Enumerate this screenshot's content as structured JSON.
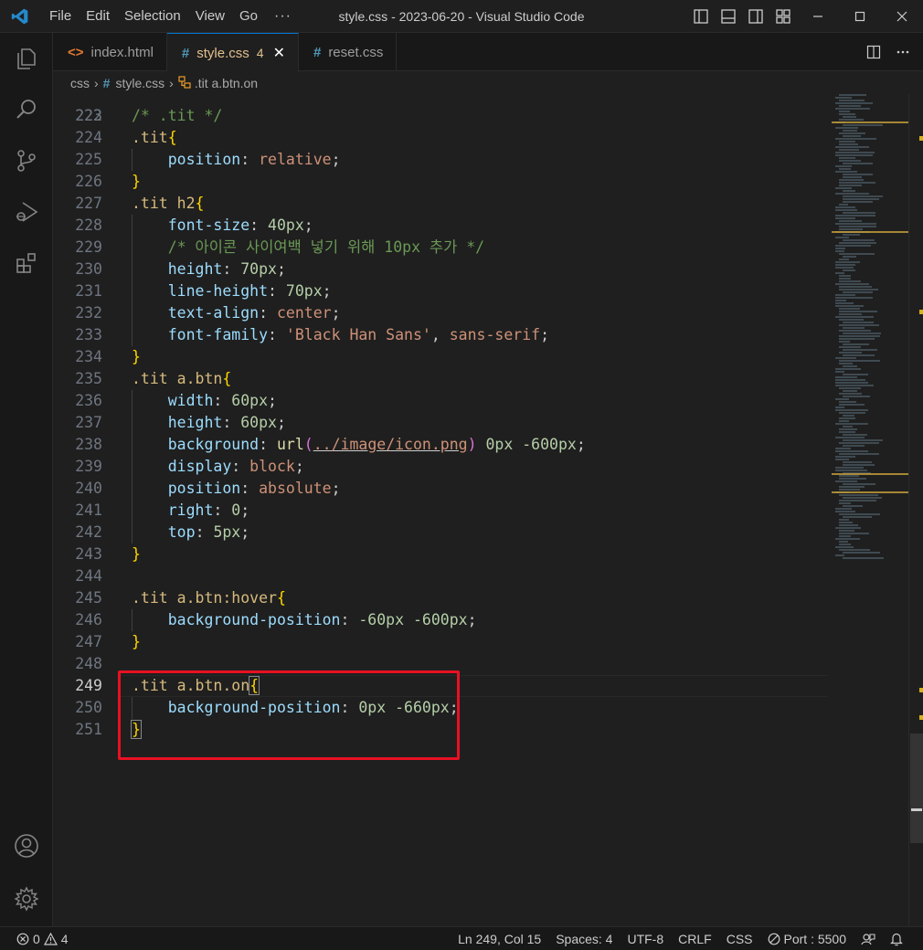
{
  "window": {
    "title": "style.css - 2023-06-20 - Visual Studio Code",
    "menu": [
      "File",
      "Edit",
      "Selection",
      "View",
      "Go"
    ],
    "menu_more": "···"
  },
  "tabs": [
    {
      "label": "index.html",
      "icon": "html-file-icon",
      "active": false
    },
    {
      "label": "style.css",
      "icon": "css-file-icon",
      "active": true,
      "problems": "4"
    },
    {
      "label": "reset.css",
      "icon": "css-file-icon",
      "active": false
    }
  ],
  "breadcrumb": {
    "folder": "css",
    "file": "style.css",
    "symbol": ".tit a.btn.on"
  },
  "editor": {
    "current_line": 249,
    "partial_top_line": "222",
    "lines": [
      {
        "n": "223",
        "tokens": [
          {
            "t": "/* .tit */",
            "c": "com"
          }
        ]
      },
      {
        "n": "224",
        "tokens": [
          {
            "t": ".tit",
            "c": "sel"
          },
          {
            "t": "{",
            "c": "br"
          }
        ]
      },
      {
        "n": "225",
        "tokens": [
          {
            "t": "    ",
            "c": "pun"
          },
          {
            "t": "position",
            "c": "prop"
          },
          {
            "t": ": ",
            "c": "pun"
          },
          {
            "t": "relative",
            "c": "val"
          },
          {
            "t": ";",
            "c": "pun"
          }
        ]
      },
      {
        "n": "226",
        "tokens": [
          {
            "t": "}",
            "c": "br"
          }
        ]
      },
      {
        "n": "227",
        "tokens": [
          {
            "t": ".tit h2",
            "c": "sel"
          },
          {
            "t": "{",
            "c": "br"
          }
        ]
      },
      {
        "n": "228",
        "tokens": [
          {
            "t": "    ",
            "c": "pun"
          },
          {
            "t": "font-size",
            "c": "prop"
          },
          {
            "t": ": ",
            "c": "pun"
          },
          {
            "t": "40px",
            "c": "num"
          },
          {
            "t": ";",
            "c": "pun"
          }
        ]
      },
      {
        "n": "229",
        "tokens": [
          {
            "t": "    ",
            "c": "pun"
          },
          {
            "t": "/* 아이콘 사이여백 넣기 위해 10px 추가 */",
            "c": "com"
          }
        ]
      },
      {
        "n": "230",
        "tokens": [
          {
            "t": "    ",
            "c": "pun"
          },
          {
            "t": "height",
            "c": "prop"
          },
          {
            "t": ": ",
            "c": "pun"
          },
          {
            "t": "70px",
            "c": "num"
          },
          {
            "t": ";",
            "c": "pun"
          }
        ]
      },
      {
        "n": "231",
        "tokens": [
          {
            "t": "    ",
            "c": "pun"
          },
          {
            "t": "line-height",
            "c": "prop"
          },
          {
            "t": ": ",
            "c": "pun"
          },
          {
            "t": "70px",
            "c": "num"
          },
          {
            "t": ";",
            "c": "pun"
          }
        ]
      },
      {
        "n": "232",
        "tokens": [
          {
            "t": "    ",
            "c": "pun"
          },
          {
            "t": "text-align",
            "c": "prop"
          },
          {
            "t": ": ",
            "c": "pun"
          },
          {
            "t": "center",
            "c": "val"
          },
          {
            "t": ";",
            "c": "pun"
          }
        ]
      },
      {
        "n": "233",
        "tokens": [
          {
            "t": "    ",
            "c": "pun"
          },
          {
            "t": "font-family",
            "c": "prop"
          },
          {
            "t": ": ",
            "c": "pun"
          },
          {
            "t": "'Black Han Sans'",
            "c": "str"
          },
          {
            "t": ", ",
            "c": "pun"
          },
          {
            "t": "sans-serif",
            "c": "val"
          },
          {
            "t": ";",
            "c": "pun"
          }
        ]
      },
      {
        "n": "234",
        "tokens": [
          {
            "t": "}",
            "c": "br"
          }
        ]
      },
      {
        "n": "235",
        "tokens": [
          {
            "t": ".tit a.btn",
            "c": "sel"
          },
          {
            "t": "{",
            "c": "br"
          }
        ]
      },
      {
        "n": "236",
        "tokens": [
          {
            "t": "    ",
            "c": "pun"
          },
          {
            "t": "width",
            "c": "prop"
          },
          {
            "t": ": ",
            "c": "pun"
          },
          {
            "t": "60px",
            "c": "num"
          },
          {
            "t": ";",
            "c": "pun"
          }
        ]
      },
      {
        "n": "237",
        "tokens": [
          {
            "t": "    ",
            "c": "pun"
          },
          {
            "t": "height",
            "c": "prop"
          },
          {
            "t": ": ",
            "c": "pun"
          },
          {
            "t": "60px",
            "c": "num"
          },
          {
            "t": ";",
            "c": "pun"
          }
        ]
      },
      {
        "n": "238",
        "tokens": [
          {
            "t": "    ",
            "c": "pun"
          },
          {
            "t": "background",
            "c": "prop"
          },
          {
            "t": ": ",
            "c": "pun"
          },
          {
            "t": "url",
            "c": "fn"
          },
          {
            "t": "(",
            "c": "par"
          },
          {
            "t": "../image/icon.png",
            "c": "url"
          },
          {
            "t": ")",
            "c": "par"
          },
          {
            "t": " ",
            "c": "pun"
          },
          {
            "t": "0px",
            "c": "num"
          },
          {
            "t": " ",
            "c": "pun"
          },
          {
            "t": "-600px",
            "c": "num"
          },
          {
            "t": ";",
            "c": "pun"
          }
        ]
      },
      {
        "n": "239",
        "tokens": [
          {
            "t": "    ",
            "c": "pun"
          },
          {
            "t": "display",
            "c": "prop"
          },
          {
            "t": ": ",
            "c": "pun"
          },
          {
            "t": "block",
            "c": "val"
          },
          {
            "t": ";",
            "c": "pun"
          }
        ]
      },
      {
        "n": "240",
        "tokens": [
          {
            "t": "    ",
            "c": "pun"
          },
          {
            "t": "position",
            "c": "prop"
          },
          {
            "t": ": ",
            "c": "pun"
          },
          {
            "t": "absolute",
            "c": "val"
          },
          {
            "t": ";",
            "c": "pun"
          }
        ]
      },
      {
        "n": "241",
        "tokens": [
          {
            "t": "    ",
            "c": "pun"
          },
          {
            "t": "right",
            "c": "prop"
          },
          {
            "t": ": ",
            "c": "pun"
          },
          {
            "t": "0",
            "c": "num"
          },
          {
            "t": ";",
            "c": "pun"
          }
        ]
      },
      {
        "n": "242",
        "tokens": [
          {
            "t": "    ",
            "c": "pun"
          },
          {
            "t": "top",
            "c": "prop"
          },
          {
            "t": ": ",
            "c": "pun"
          },
          {
            "t": "5px",
            "c": "num"
          },
          {
            "t": ";",
            "c": "pun"
          }
        ]
      },
      {
        "n": "243",
        "tokens": [
          {
            "t": "}",
            "c": "br"
          }
        ]
      },
      {
        "n": "244",
        "tokens": []
      },
      {
        "n": "245",
        "tokens": [
          {
            "t": ".tit a.btn:hover",
            "c": "sel"
          },
          {
            "t": "{",
            "c": "br"
          }
        ]
      },
      {
        "n": "246",
        "tokens": [
          {
            "t": "    ",
            "c": "pun"
          },
          {
            "t": "background-position",
            "c": "prop"
          },
          {
            "t": ": ",
            "c": "pun"
          },
          {
            "t": "-60px",
            "c": "num"
          },
          {
            "t": " ",
            "c": "pun"
          },
          {
            "t": "-600px",
            "c": "num"
          },
          {
            "t": ";",
            "c": "pun"
          }
        ]
      },
      {
        "n": "247",
        "tokens": [
          {
            "t": "}",
            "c": "br"
          }
        ]
      },
      {
        "n": "248",
        "tokens": []
      },
      {
        "n": "249",
        "tokens": [
          {
            "t": ".tit a.btn.on",
            "c": "sel"
          },
          {
            "t": "{",
            "c": "br",
            "box": true
          }
        ]
      },
      {
        "n": "250",
        "tokens": [
          {
            "t": "    ",
            "c": "pun"
          },
          {
            "t": "background-position",
            "c": "prop"
          },
          {
            "t": ": ",
            "c": "pun"
          },
          {
            "t": "0px",
            "c": "num"
          },
          {
            "t": " ",
            "c": "pun"
          },
          {
            "t": "-660px",
            "c": "num"
          },
          {
            "t": ";",
            "c": "pun"
          }
        ]
      },
      {
        "n": "251",
        "tokens": [
          {
            "t": "}",
            "c": "br",
            "box": true
          }
        ]
      }
    ]
  },
  "statusbar": {
    "errors": "0",
    "warnings": "4",
    "position": "Ln 249, Col 15",
    "spaces": "Spaces: 4",
    "encoding": "UTF-8",
    "eol": "CRLF",
    "language": "CSS",
    "port": "Port : 5500"
  },
  "colors": {
    "accent": "#0078d4",
    "highlight_box": "#e81123",
    "modified_tab": "#e2c08d"
  }
}
